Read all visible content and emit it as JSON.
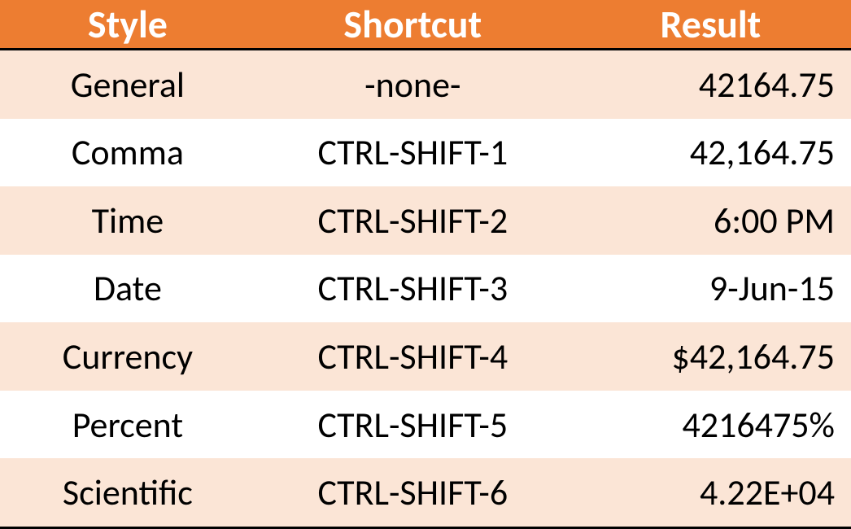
{
  "headers": {
    "style": "Style",
    "shortcut": "Shortcut",
    "result": "Result"
  },
  "rows": [
    {
      "style": "General",
      "shortcut": "-none-",
      "result": "42164.75"
    },
    {
      "style": "Comma",
      "shortcut": "CTRL-SHIFT-1",
      "result": "42,164.75"
    },
    {
      "style": "Time",
      "shortcut": "CTRL-SHIFT-2",
      "result": "6:00 PM"
    },
    {
      "style": "Date",
      "shortcut": "CTRL-SHIFT-3",
      "result": "9-Jun-15"
    },
    {
      "style": "Currency",
      "shortcut": "CTRL-SHIFT-4",
      "result": "$42,164.75"
    },
    {
      "style": "Percent",
      "shortcut": "CTRL-SHIFT-5",
      "result": "4216475%"
    },
    {
      "style": "Scientific",
      "shortcut": "CTRL-SHIFT-6",
      "result": "4.22E+04"
    }
  ]
}
